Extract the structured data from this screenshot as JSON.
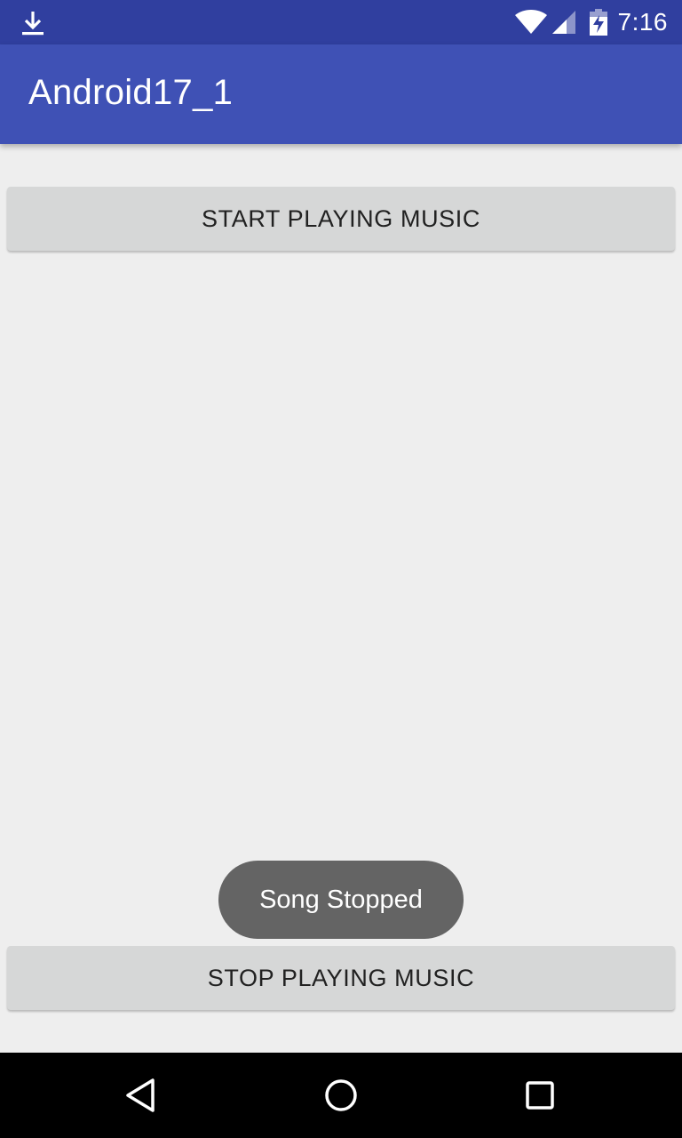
{
  "status_bar": {
    "time": "7:16",
    "icons": [
      "download-icon",
      "wifi-icon",
      "signal-icon",
      "battery-charging-icon"
    ]
  },
  "app_bar": {
    "title": "Android17_1"
  },
  "main": {
    "start_button_label": "START PLAYING MUSIC",
    "stop_button_label": "STOP PLAYING MUSIC"
  },
  "toast": {
    "message": "Song Stopped"
  },
  "nav_bar": {
    "icons": [
      "back-icon",
      "home-icon",
      "recents-icon"
    ]
  },
  "colors": {
    "status_bar": "#303f9f",
    "app_bar": "#3f51b5",
    "background": "#eeeeee",
    "button": "#d6d7d7",
    "toast": "#646464",
    "nav_bar": "#000000"
  }
}
